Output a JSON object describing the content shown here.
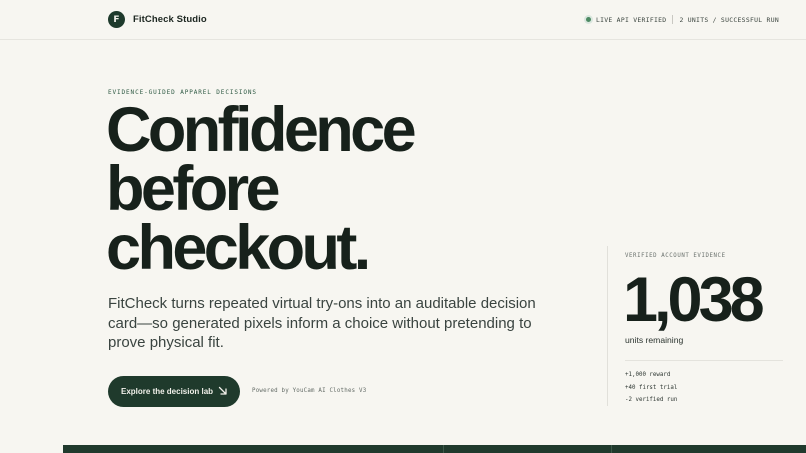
{
  "header": {
    "logo_letter": "F",
    "brand": "FitCheck Studio",
    "status_live": "LIVE API VERIFIED",
    "status_units": "2 UNITS / SUCCESSFUL RUN"
  },
  "hero": {
    "eyebrow": "EVIDENCE-GUIDED APPAREL DECISIONS",
    "headline": [
      "Confidence",
      "before",
      "checkout."
    ],
    "lede": "FitCheck turns repeated virtual try-ons into an auditable decision card—so generated pixels inform a choice without pretending to prove physical fit.",
    "cta_label": "Explore the decision lab",
    "powered_by": "Powered by YouCam AI Clothes V3"
  },
  "evidence": {
    "label": "VERIFIED ACCOUNT EVIDENCE",
    "number": "1,038",
    "unit": "units remaining",
    "items": [
      "+1,000 reward",
      "+40 first trial",
      "-2 verified run"
    ]
  },
  "colors": {
    "background": "#f7f6f1",
    "brand_green": "#1f3a2c",
    "live_dot": "#4d8a63",
    "ink": "#17211b"
  },
  "icons": {
    "cta": "arrow-down-right-icon",
    "status": "live-dot-icon"
  }
}
